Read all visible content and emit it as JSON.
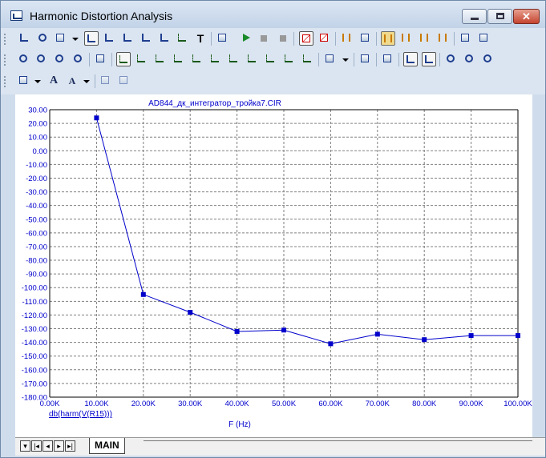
{
  "window": {
    "title": "Harmonic Distortion Analysis",
    "buttons": {
      "minimize": "minimize",
      "maximize": "maximize",
      "close": "✕"
    }
  },
  "toolbar": {
    "text_tool_glyph": "T",
    "font_glyph": "A",
    "font_size_glyph": "A"
  },
  "plot": {
    "title": "AD844_дк_интегратор_тройка7.CIR",
    "trace_label": "db(harm(V(R15)))",
    "trace_color": "#0000cc",
    "grid_color": "#808080"
  },
  "tabs": {
    "main_label": "MAIN"
  },
  "chart_data": {
    "type": "line",
    "title": "AD844_дк_интегратор_тройка7.CIR",
    "xlabel": "F (Hz)",
    "ylabel": "",
    "xlim": [
      0,
      100000
    ],
    "ylim": [
      -180,
      30
    ],
    "grid": true,
    "x_ticks": [
      "0.00K",
      "10.00K",
      "20.00K",
      "30.00K",
      "40.00K",
      "50.00K",
      "60.00K",
      "70.00K",
      "80.00K",
      "90.00K",
      "100.00K"
    ],
    "y_ticks": [
      "30.00",
      "20.00",
      "10.00",
      "0.00",
      "-10.00",
      "-20.00",
      "-30.00",
      "-40.00",
      "-50.00",
      "-60.00",
      "-70.00",
      "-80.00",
      "-90.00",
      "-100.00",
      "-110.00",
      "-120.00",
      "-130.00",
      "-140.00",
      "-150.00",
      "-160.00",
      "-170.00",
      "-180.00"
    ],
    "series": [
      {
        "name": "db(harm(V(R15)))",
        "x": [
          10000,
          20000,
          30000,
          40000,
          50000,
          60000,
          70000,
          80000,
          90000,
          100000
        ],
        "y": [
          24,
          -105,
          -118,
          -132,
          -131,
          -141,
          -134,
          -138,
          -135,
          -135
        ]
      }
    ]
  }
}
